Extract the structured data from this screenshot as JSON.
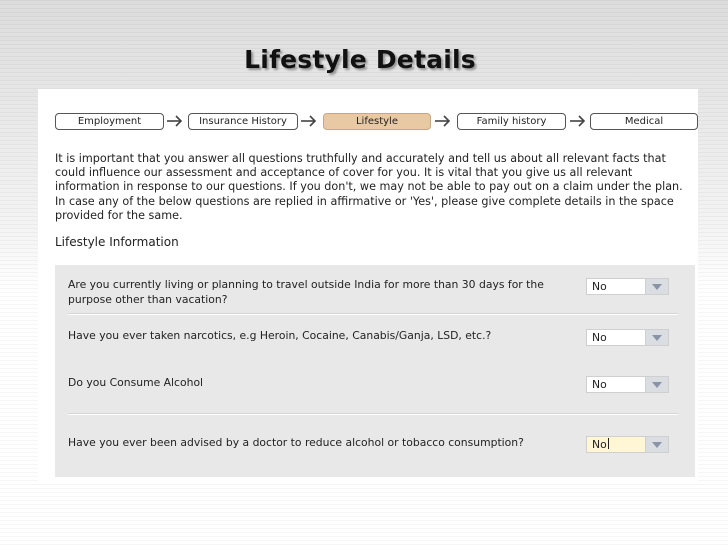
{
  "slide": {
    "title": "Lifestyle  Details"
  },
  "steps": [
    {
      "label": "Employment",
      "active": false
    },
    {
      "label": "Insurance History",
      "active": false
    },
    {
      "label": "Lifestyle",
      "active": true
    },
    {
      "label": "Family history",
      "active": false
    },
    {
      "label": "Medical",
      "active": false
    }
  ],
  "intro_text": "It is important that you answer all questions truthfully and accurately and tell us about all relevant facts that could influence our assessment and acceptance of cover for you. It is vital that you give us all relevant information in response to our questions. If you don't, we may not be able to pay out on a claim under the plan. In case any of the below questions are replied in affirmative or 'Yes', please give complete details in the space provided for the same.",
  "section_title": "Lifestyle Information",
  "questions": [
    {
      "text": "Are you currently living or planning to travel outside India for more than 30 days for the purpose other than vacation?",
      "answer": "No"
    },
    {
      "text": "Have you ever taken narcotics, e.g Heroin, Cocaine, Canabis/Ganja, LSD, etc.?",
      "answer": "No"
    },
    {
      "text": "Do you Consume Alcohol",
      "answer": "No"
    },
    {
      "text": "Have you ever been advised by a doctor to reduce alcohol or tobacco consumption?",
      "answer": "No"
    }
  ],
  "icons": {
    "step_separator": "arrow-right-icon",
    "dropdown": "triangle-down-icon"
  },
  "colors": {
    "active_step": "#e8c9a4",
    "question_panel": "#e8e8e8",
    "focused_field": "#fff6d6"
  }
}
